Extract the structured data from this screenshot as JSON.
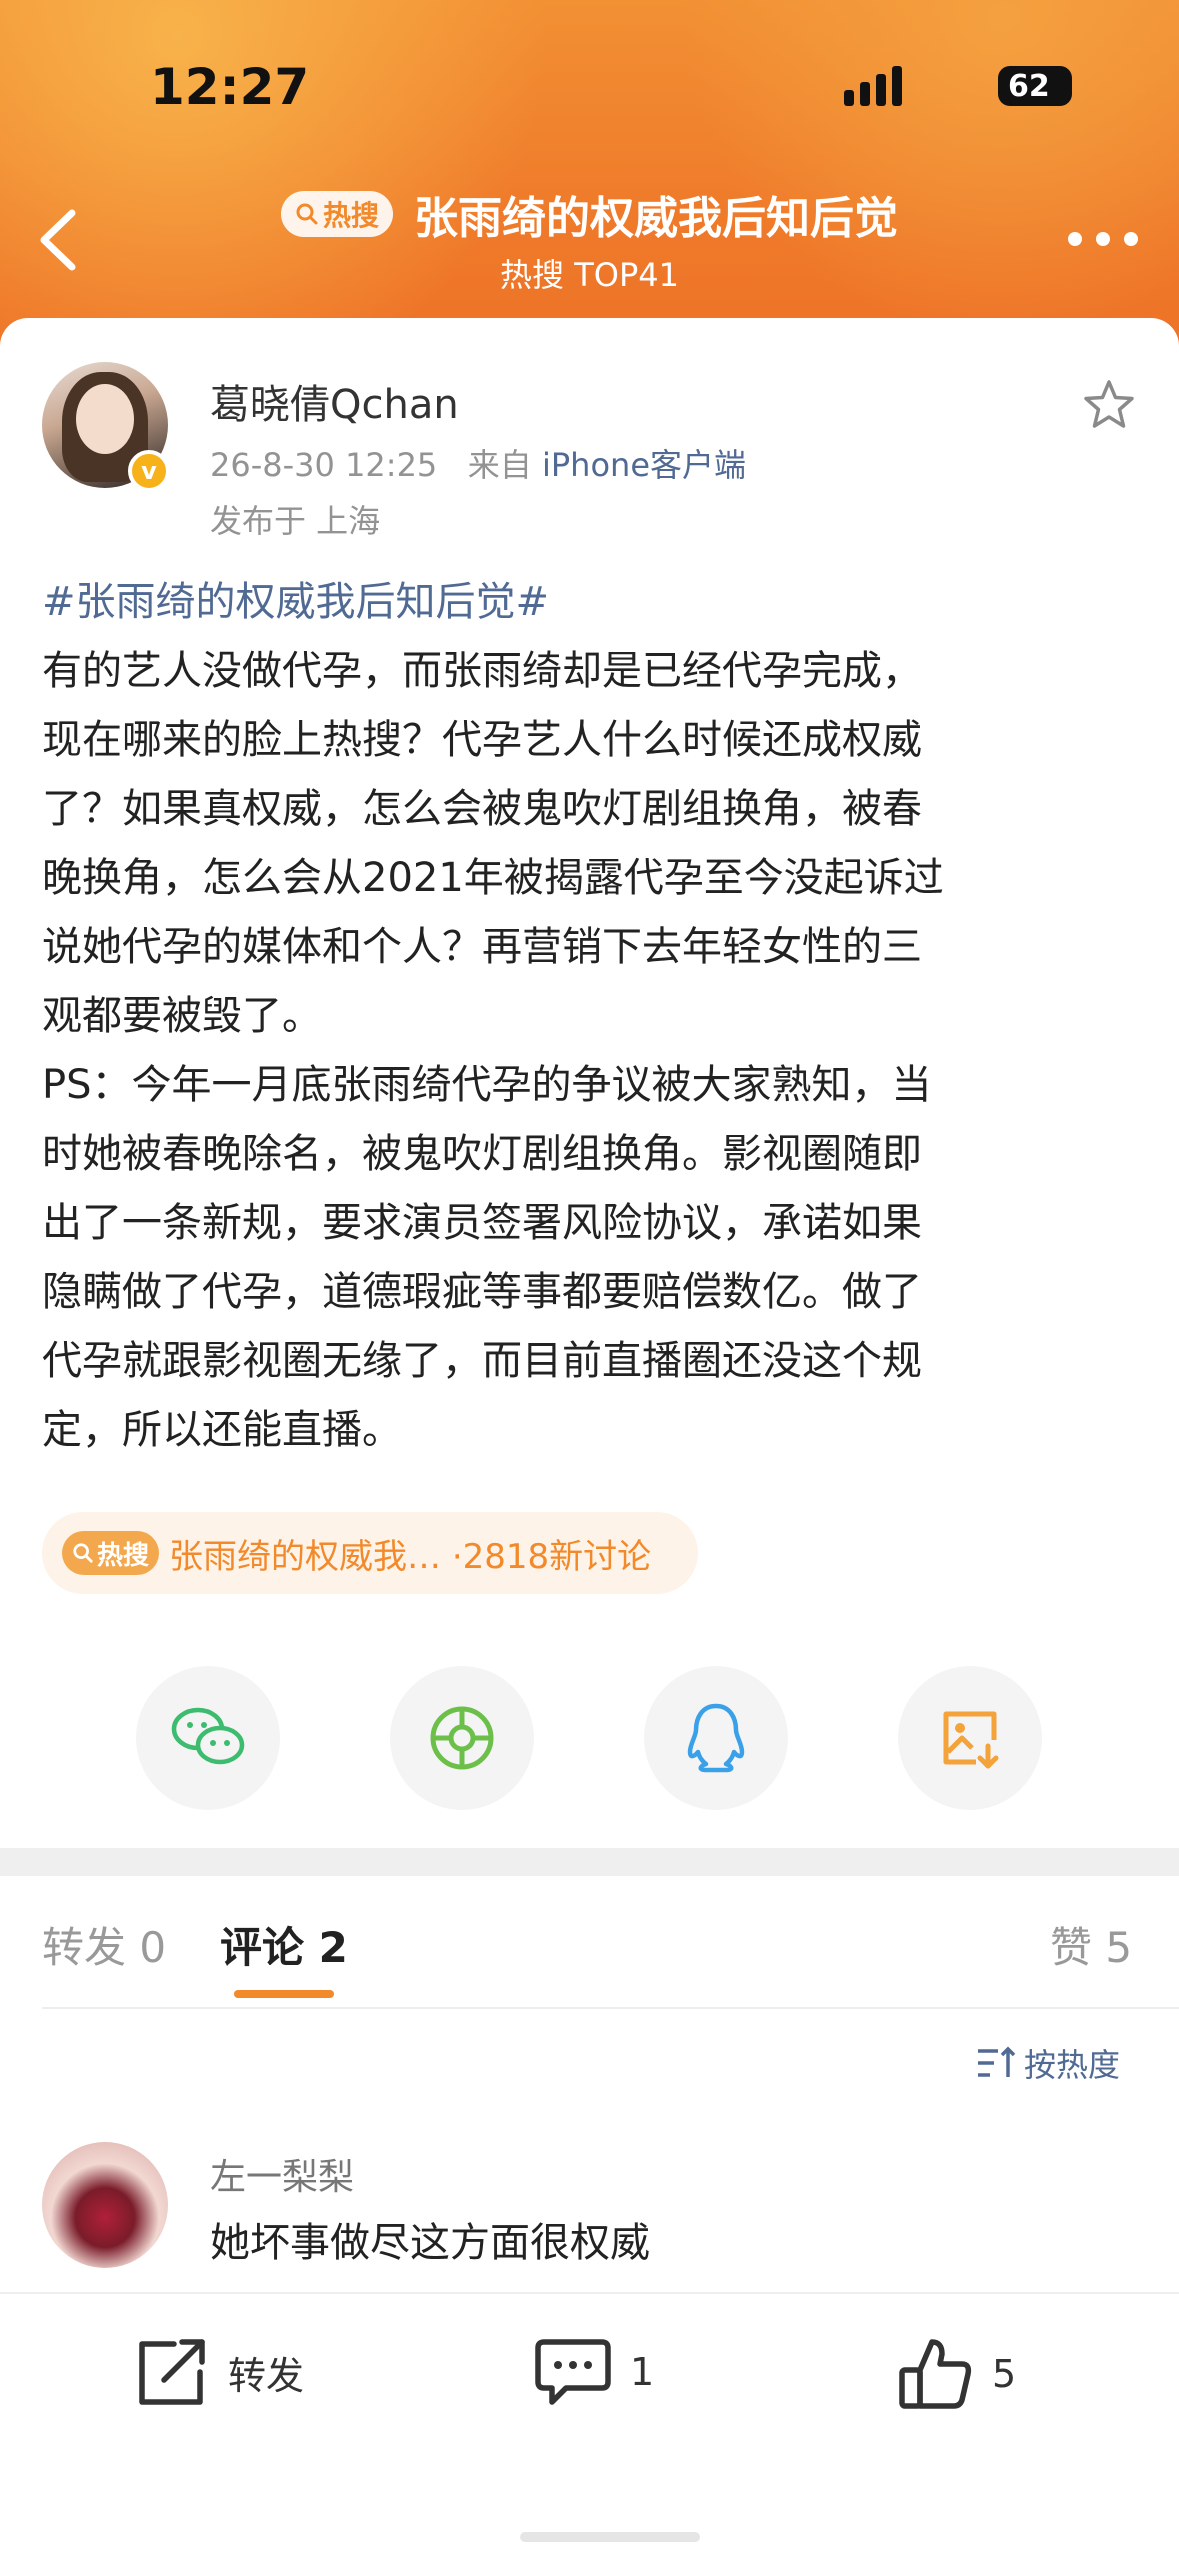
{
  "status_bar": {
    "time": "12:27",
    "battery": "62",
    "battery_level_percent": 62
  },
  "header": {
    "hot_badge": "热搜",
    "title": "张雨绮的权威我后知后觉",
    "subtitle": "热搜 TOP41"
  },
  "post": {
    "username": "葛晓倩Qchan",
    "timestamp": "26-8-30 12:25",
    "source_prefix": "来自",
    "source": "iPhone客户端",
    "location": "发布于 上海",
    "hashtag": "#张雨绮的权威我后知后觉#",
    "lines": [
      "有的艺人没做代孕，而张雨绮却是已经代孕完成，",
      "现在哪来的脸上热搜？代孕艺人什么时候还成权威",
      "了？如果真权威，怎么会被鬼吹灯剧组换角，被春",
      "晚换角，怎么会从2021年被揭露代孕至今没起诉过",
      "说她代孕的媒体和个人？再营销下去年轻女性的三",
      "观都要被毁了。",
      "PS：今年一月底张雨绮代孕的争议被大家熟知，当",
      "时她被春晚除名，被鬼吹灯剧组换角。影视圈随即",
      "出了一条新规，要求演员签署风险协议，承诺如果",
      "隐瞒做了代孕，道德瑕疵等事都要赔偿数亿。做了",
      "代孕就跟影视圈无缘了，而目前直播圈还没这个规",
      "定，所以还能直播。"
    ]
  },
  "topic": {
    "badge": "热搜",
    "text": "张雨绮的权威我… ·2818新讨论"
  },
  "share": {
    "icons": [
      "wechat-icon",
      "moments-icon",
      "qq-icon",
      "save-image-icon"
    ],
    "colors": {
      "wechat": "#3dbb6e",
      "moments": "#6cc04a",
      "qq": "#3aa0e8",
      "save": "#f4a23a"
    }
  },
  "tabs": {
    "repost": "转发 0",
    "comments": "评论 2",
    "likes": "赞 5"
  },
  "sort_label": "按热度",
  "comment": {
    "name": "左一梨梨",
    "text": "她坏事做尽这方面很权威"
  },
  "bottom_bar": {
    "repost": "转发",
    "comment_count": "1",
    "like_count": "5"
  },
  "colors": {
    "accent": "#f28a2b",
    "link": "#506a94"
  }
}
